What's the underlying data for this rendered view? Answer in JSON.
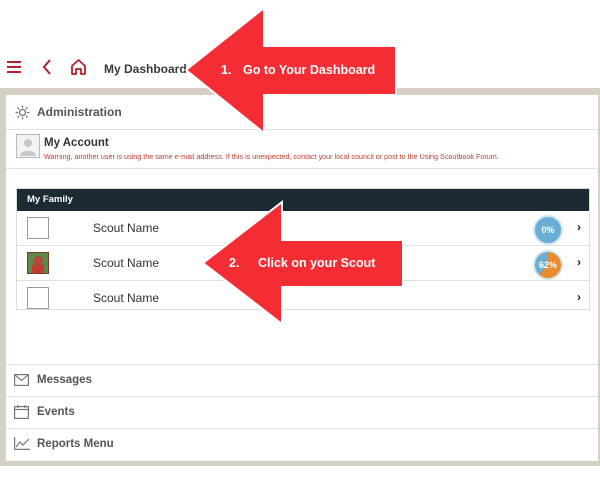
{
  "header": {
    "title": "My Dashboard"
  },
  "administration": {
    "label": "Administration"
  },
  "my_account": {
    "title": "My Account",
    "warning": "Warning, another user is using the same e-mail address. If this is unexpected, contact your local council or post to the Using Scoutbook Forum."
  },
  "my_family": {
    "title": "My Family",
    "scouts": [
      {
        "name": "Scout Name",
        "progress": "0%"
      },
      {
        "name": "Scout Name",
        "progress": "62%"
      },
      {
        "name": "Scout Name"
      }
    ]
  },
  "menu": {
    "messages": "Messages",
    "events": "Events",
    "reports": "Reports Menu"
  },
  "callouts": {
    "step1_number": "1.",
    "step1_text": "Go to Your Dashboard",
    "step2_number": "2.",
    "step2_text": "Click on your Scout"
  },
  "colors": {
    "accent": "#b41f2b",
    "arrow": "#f42c33",
    "family_header": "#1c2a33"
  }
}
